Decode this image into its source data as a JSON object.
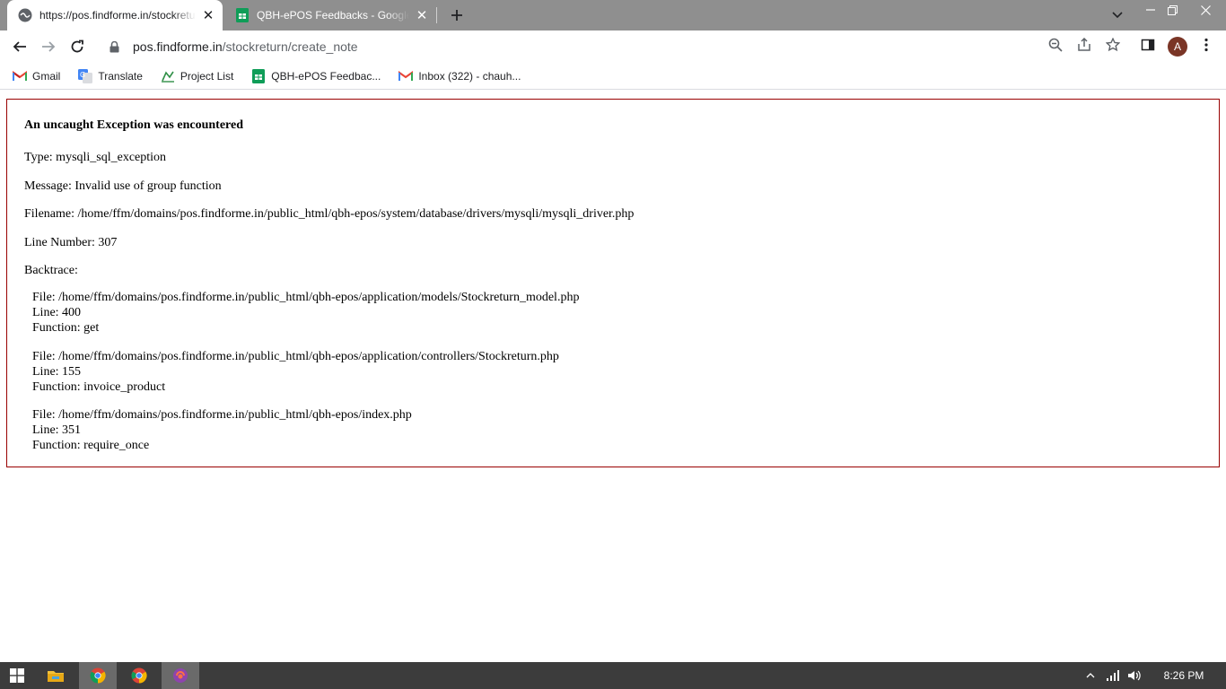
{
  "browser": {
    "tabs": [
      {
        "title": "https://pos.findforme.in/stockreturn/create_note",
        "active": true
      },
      {
        "title": "QBH-ePOS Feedbacks - Google Sheets",
        "active": false
      }
    ],
    "address": {
      "host": "pos.findforme.in",
      "path": "/stockreturn/create_note"
    },
    "profile_initial": "A",
    "bookmarks": [
      {
        "label": "Gmail",
        "icon": "gmail-icon"
      },
      {
        "label": "Translate",
        "icon": "translate-icon"
      },
      {
        "label": "Project List",
        "icon": "project-list-icon"
      },
      {
        "label": "QBH-ePOS Feedbac...",
        "icon": "sheets-icon"
      },
      {
        "label": "Inbox (322) - chauh...",
        "icon": "gmail-icon"
      }
    ]
  },
  "error": {
    "heading": "An uncaught Exception was encountered",
    "type": "Type: mysqli_sql_exception",
    "message": "Message: Invalid use of group function",
    "filename": "Filename: /home/ffm/domains/pos.findforme.in/public_html/qbh-epos/system/database/drivers/mysqli/mysqli_driver.php",
    "line_number": "Line Number: 307",
    "backtrace_label": "Backtrace:",
    "backtrace": [
      {
        "file": "File: /home/ffm/domains/pos.findforme.in/public_html/qbh-epos/application/models/Stockreturn_model.php",
        "line": "Line: 400",
        "function": "Function: get"
      },
      {
        "file": "File: /home/ffm/domains/pos.findforme.in/public_html/qbh-epos/application/controllers/Stockreturn.php",
        "line": "Line: 155",
        "function": "Function: invoice_product"
      },
      {
        "file": "File: /home/ffm/domains/pos.findforme.in/public_html/qbh-epos/index.php",
        "line": "Line: 351",
        "function": "Function: require_once"
      }
    ]
  },
  "taskbar": {
    "clock": "8:26 PM"
  },
  "colors": {
    "tabstrip": "#8f8f8f",
    "error_border": "#990000",
    "taskbar": "#3c3c3c"
  }
}
